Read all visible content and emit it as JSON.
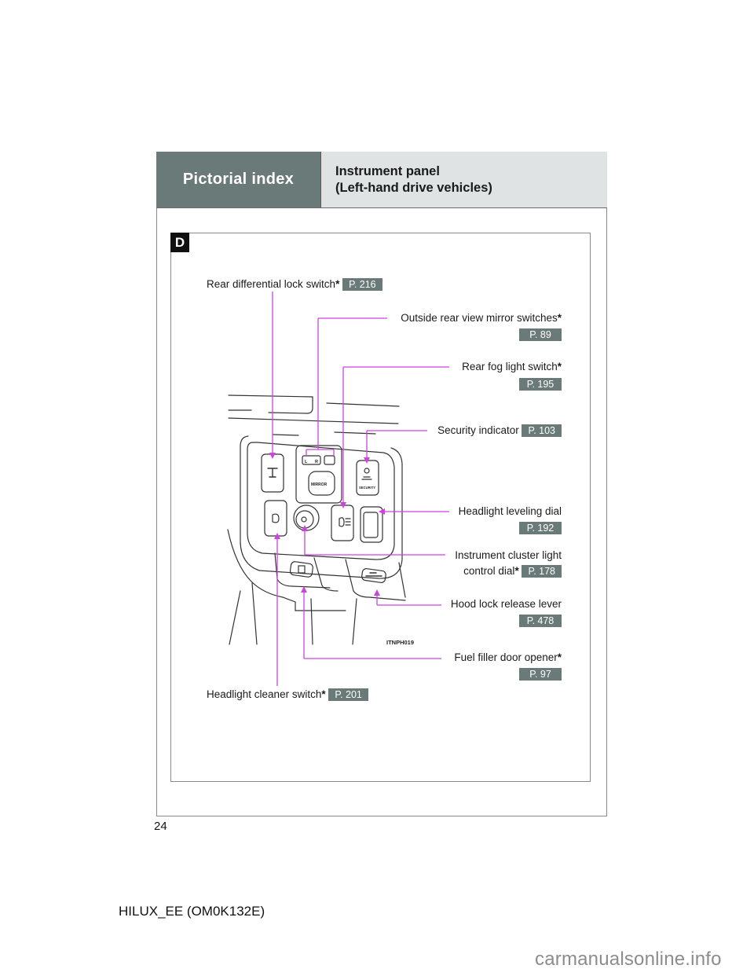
{
  "header": {
    "section": "Pictorial index",
    "title_line1": "Instrument panel",
    "title_line2": "(Left-hand drive vehicles)"
  },
  "section_badge": "D",
  "accent_colors": {
    "callout_line": "#cc44dd",
    "page_ref_bg": "#6a7a78",
    "header_left_bg": "#6a7a78",
    "header_right_bg": "#dfe3e3"
  },
  "callouts": [
    {
      "label": "Rear differential lock switch",
      "asterisk": "*",
      "page_ref": "P. 216"
    },
    {
      "label": "Outside rear view mirror switches",
      "asterisk": "*",
      "page_ref": "P. 89"
    },
    {
      "label": "Rear fog light switch",
      "asterisk": "*",
      "page_ref": "P. 195"
    },
    {
      "label": "Security indicator",
      "asterisk": "",
      "page_ref": "P. 103"
    },
    {
      "label": "Headlight leveling dial",
      "asterisk": "",
      "page_ref": "P. 192"
    },
    {
      "label_line1": "Instrument cluster light",
      "label": "control dial",
      "asterisk": "*",
      "page_ref": "P. 178"
    },
    {
      "label": "Hood lock release lever",
      "asterisk": "",
      "page_ref": "P. 478"
    },
    {
      "label": "Fuel filler door opener",
      "asterisk": "*",
      "page_ref": "P. 97"
    },
    {
      "label": "Headlight cleaner switch",
      "asterisk": "*",
      "page_ref": "P. 201"
    }
  ],
  "illustration": {
    "figure_code": "ITNPH019",
    "switch_texts": {
      "mirror_l": "L",
      "mirror_r": "R",
      "mirror_knob": "MIRROR",
      "security": "SECURITY"
    }
  },
  "footer": {
    "page_number": "24",
    "document_id": "HILUX_EE (OM0K132E)",
    "watermark": "carmanualsonline.info"
  }
}
